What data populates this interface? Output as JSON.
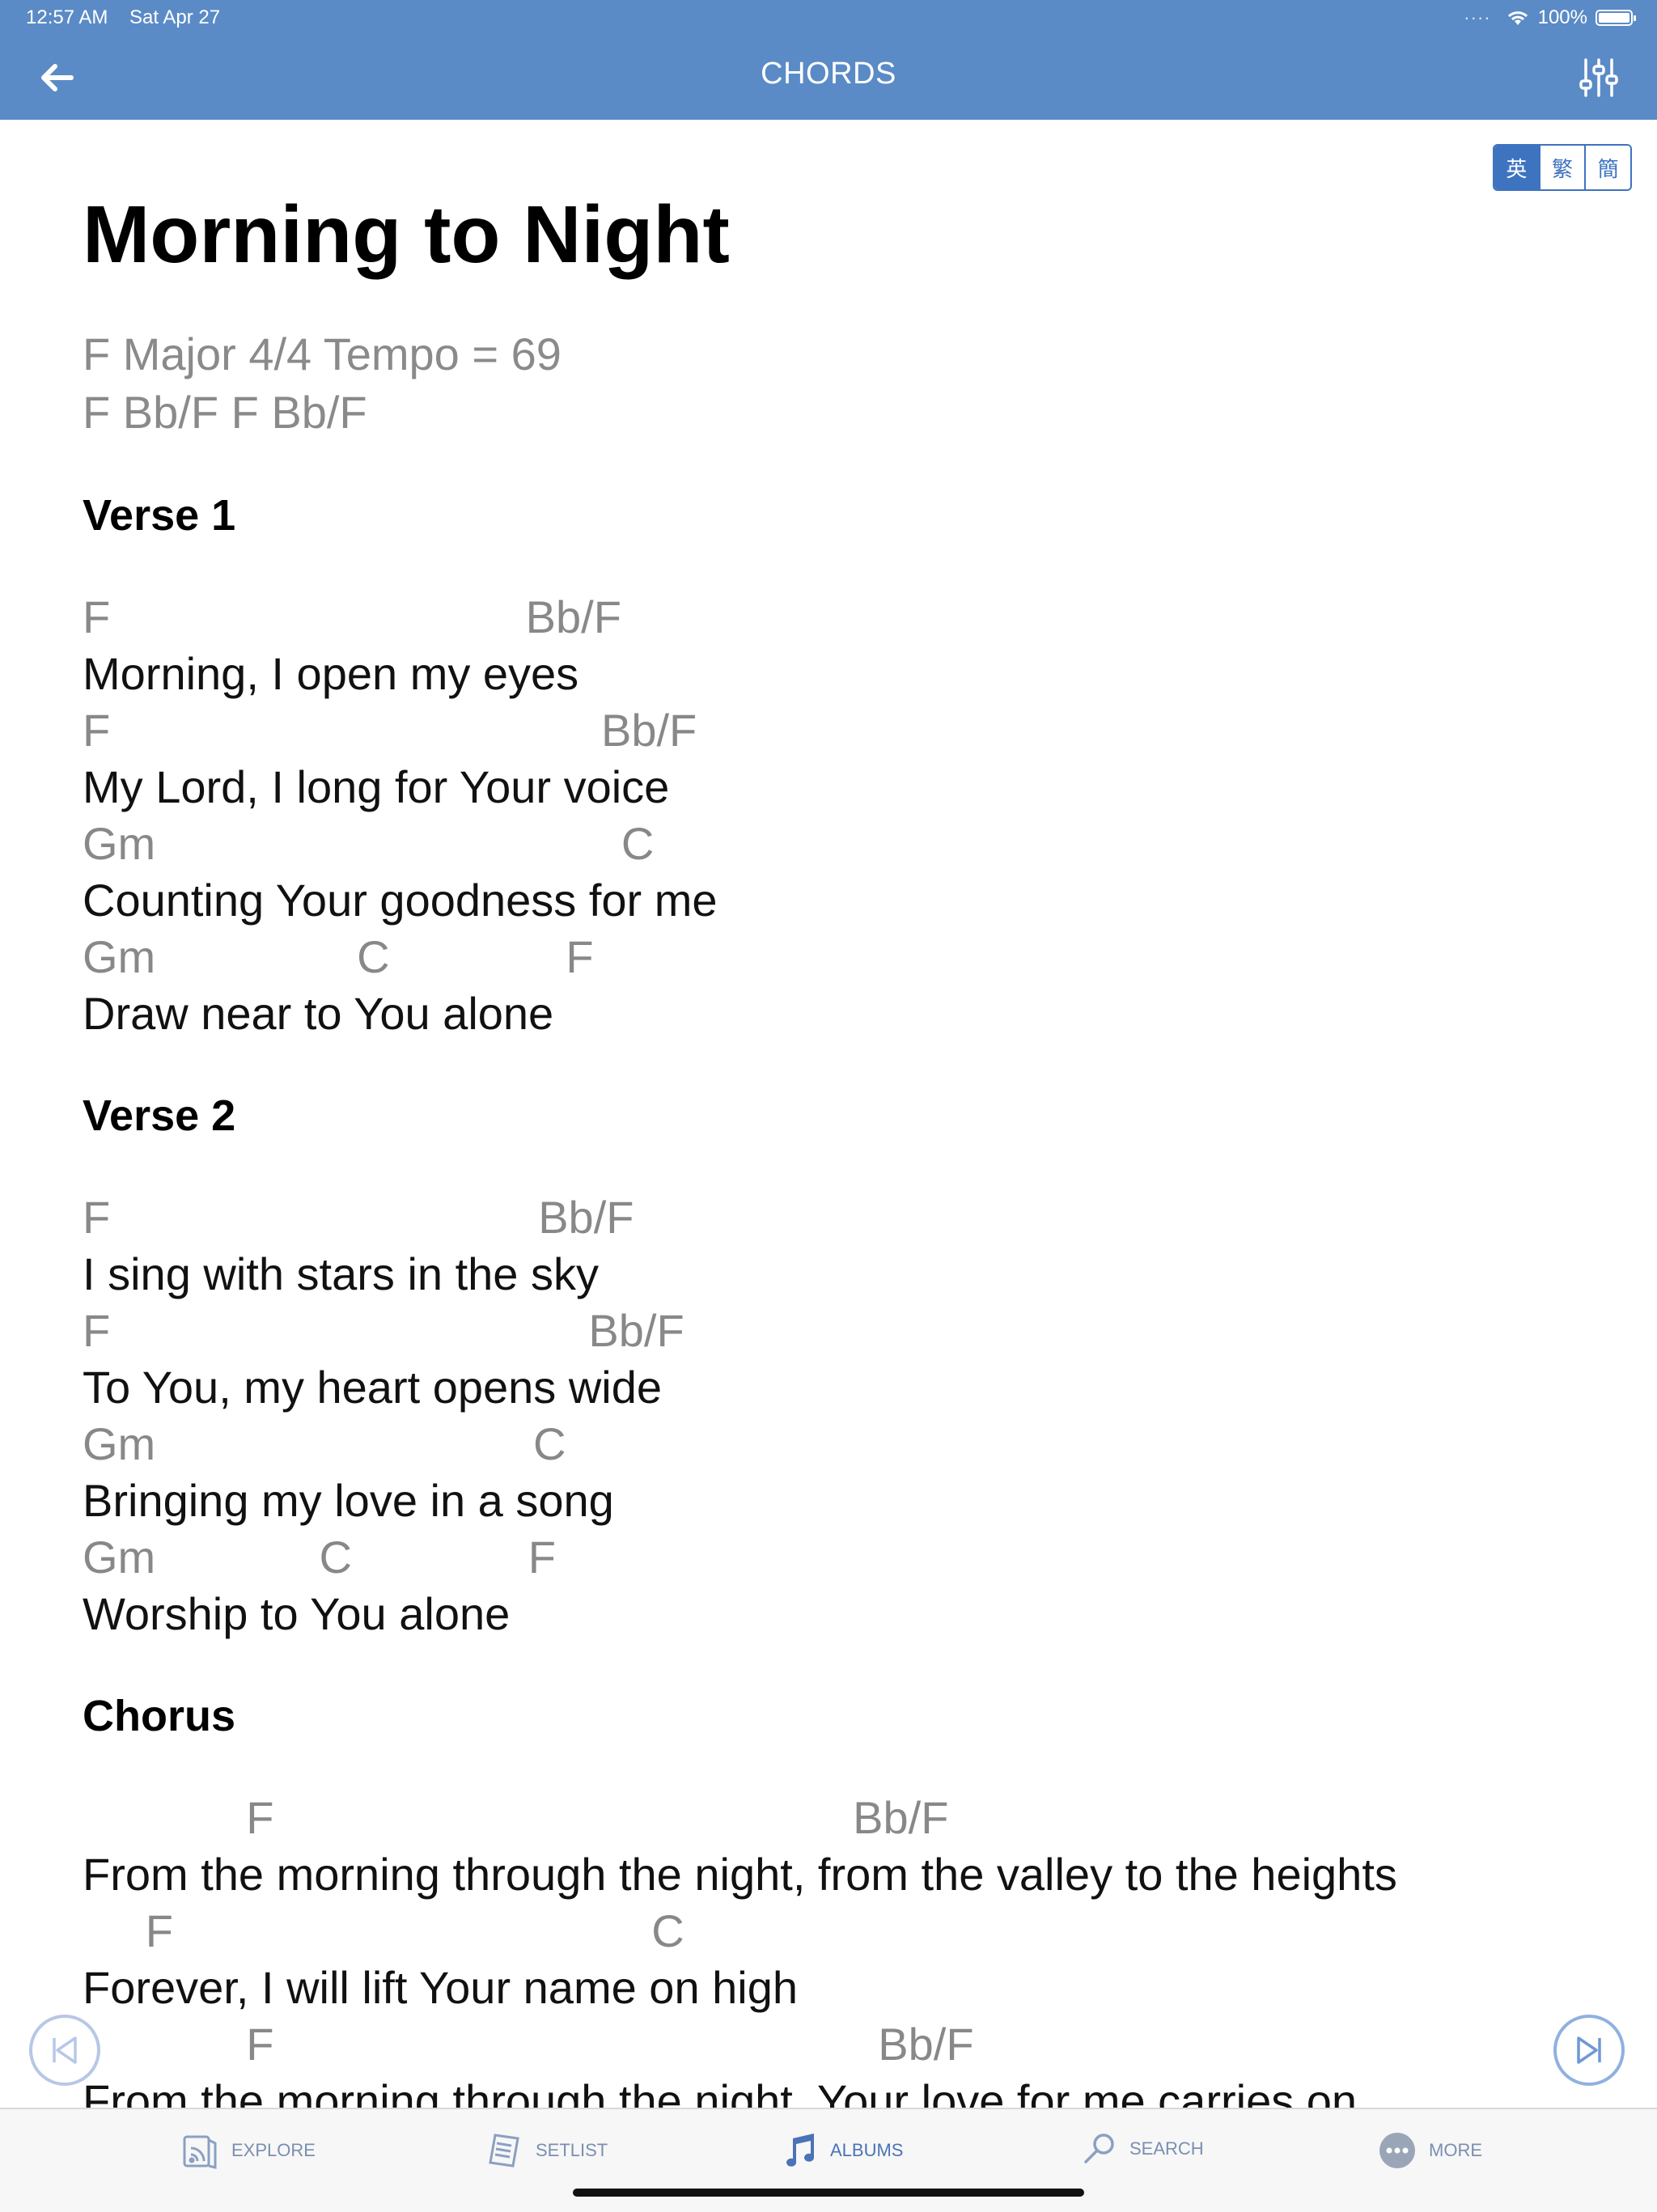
{
  "status": {
    "time": "12:57 AM",
    "date": "Sat Apr 27",
    "battery": "100%"
  },
  "nav": {
    "title": "CHORDS",
    "back_icon": "arrow-left-icon",
    "settings_icon": "sliders-icon"
  },
  "language_toggle": {
    "options": [
      "英",
      "繁",
      "簡"
    ],
    "selected": "英"
  },
  "song": {
    "title": "Morning to Night",
    "meta_line1": "F Major 4/4 Tempo = 69",
    "meta_line2": "F  Bb/F  F  Bb/F",
    "sections": [
      {
        "title": "Verse 1",
        "lines": [
          {
            "chord": "F                                 Bb/F",
            "lyric": "Morning, I open my eyes"
          },
          {
            "chord": "F                                       Bb/F",
            "lyric": "My Lord, I long for Your voice"
          },
          {
            "chord": "Gm                                     C",
            "lyric": "Counting Your goodness for me"
          },
          {
            "chord": "Gm                C              F",
            "lyric": "Draw near to You alone"
          }
        ]
      },
      {
        "title": "Verse 2",
        "lines": [
          {
            "chord": "F                                  Bb/F",
            "lyric": "I sing with stars in the sky"
          },
          {
            "chord": "F                                      Bb/F",
            "lyric": "To You, my heart opens wide"
          },
          {
            "chord": "Gm                              C",
            "lyric": "Bringing my love in a song"
          },
          {
            "chord": "Gm             C              F",
            "lyric": "Worship to You alone"
          }
        ]
      },
      {
        "title": "Chorus",
        "lines": [
          {
            "chord": "             F                                              Bb/F",
            "lyric": "From the morning through the night, from the valley to the heights"
          },
          {
            "chord": "     F                                      C",
            "lyric": "Forever, I will lift Your name on high"
          },
          {
            "chord": "             F                                                Bb/F",
            "lyric": "From the morning through the night, Your love for me carries on"
          }
        ]
      }
    ]
  },
  "tabs": [
    {
      "label": "EXPLORE",
      "icon": "rss-book-icon"
    },
    {
      "label": "SETLIST",
      "icon": "setlist-icon"
    },
    {
      "label": "ALBUMS",
      "icon": "music-note-icon",
      "active": true
    },
    {
      "label": "SEARCH",
      "icon": "search-icon"
    },
    {
      "label": "MORE",
      "icon": "more-dots-icon"
    }
  ],
  "colors": {
    "nav_bar": "#5b8bc6",
    "accent": "#3e73c0",
    "chord_text": "#888888"
  }
}
